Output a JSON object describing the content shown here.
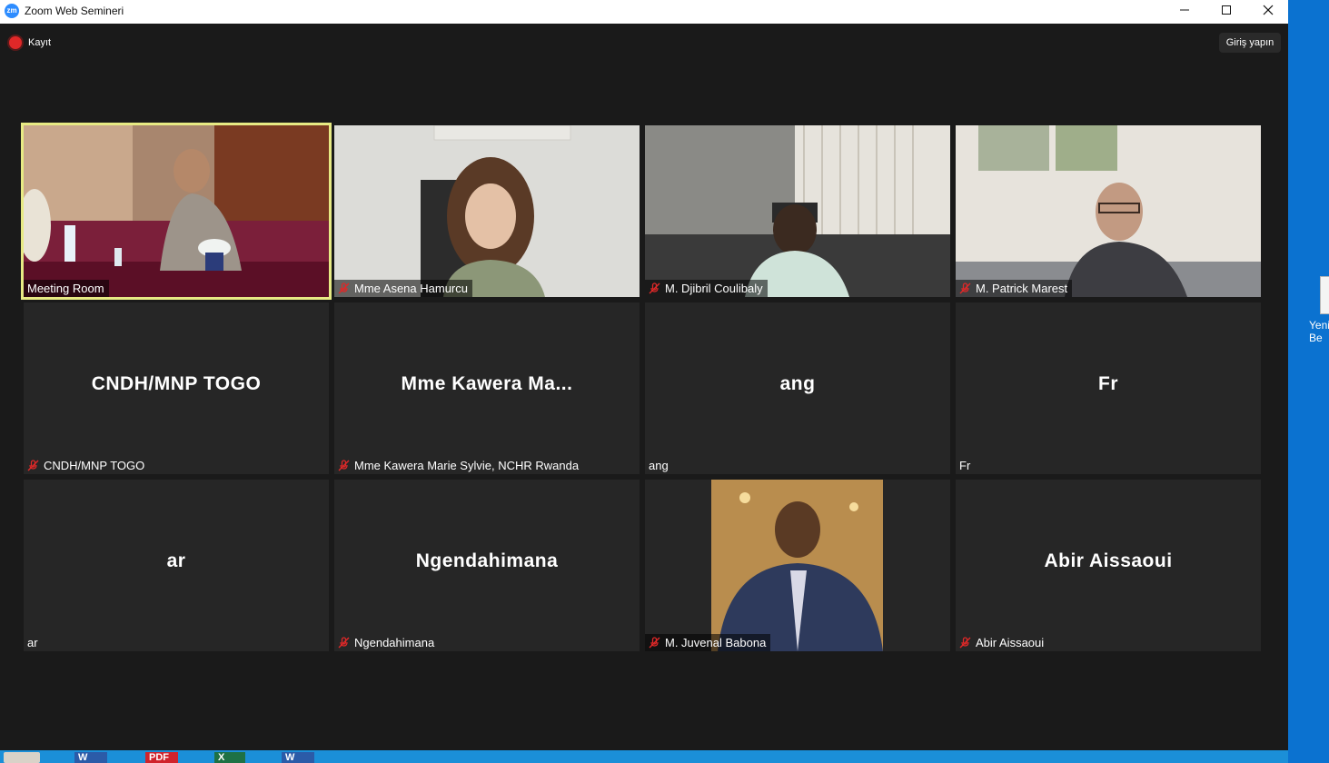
{
  "window": {
    "title": "Zoom Web Semineri",
    "app_icon_text": "zm",
    "controls": [
      "minimize",
      "maximize",
      "close"
    ]
  },
  "toolbar": {
    "recording_label": "Kayıt",
    "login_label": "Giriş yapın"
  },
  "tiles": [
    {
      "name_label": "Meeting Room",
      "video": "meeting-room",
      "muted": false,
      "active_speaker": true
    },
    {
      "name_label": "Mme Asena Hamurcu",
      "video": "woman",
      "muted": true
    },
    {
      "name_label": "M. Djibril Coulibaly",
      "video": "man-window",
      "muted": true
    },
    {
      "name_label": "M. Patrick Marest",
      "video": "man-glasses",
      "muted": true
    },
    {
      "big_name": "CNDH/MNP TOGO",
      "name_label": "CNDH/MNP TOGO",
      "muted": true
    },
    {
      "big_name": "Mme Kawera Ma...",
      "name_label": "Mme Kawera Marie Sylvie, NCHR Rwanda",
      "muted": true
    },
    {
      "big_name": "ang",
      "name_label": "ang",
      "muted": false
    },
    {
      "big_name": "Fr",
      "name_label": "Fr",
      "muted": false
    },
    {
      "big_name": "ar",
      "name_label": "ar",
      "muted": false
    },
    {
      "big_name": "Ngendahimana",
      "name_label": "Ngendahimana",
      "muted": true
    },
    {
      "name_label": "M. Juvenal Babona",
      "video": "profile-photo",
      "muted": true
    },
    {
      "big_name": "Abir Aissaoui",
      "name_label": "Abir Aissaoui",
      "muted": true
    }
  ],
  "desktop": {
    "icon_label": "Yeni\nBe"
  },
  "taskbar": {
    "items": [
      {
        "icon": "user-avatar-icon"
      },
      {
        "icon": "word-icon",
        "text": "W"
      },
      {
        "icon": "pdf-icon",
        "text": "PDF"
      },
      {
        "icon": "excel-icon",
        "text": "X"
      },
      {
        "icon": "word-icon",
        "text": "W"
      }
    ]
  },
  "colors": {
    "active_speaker_border": "#e7ea84",
    "mute_red": "#e02828",
    "window_bg": "#1a1a1a",
    "tile_bg": "#262626",
    "desktop_blue": "#0b72d0"
  }
}
